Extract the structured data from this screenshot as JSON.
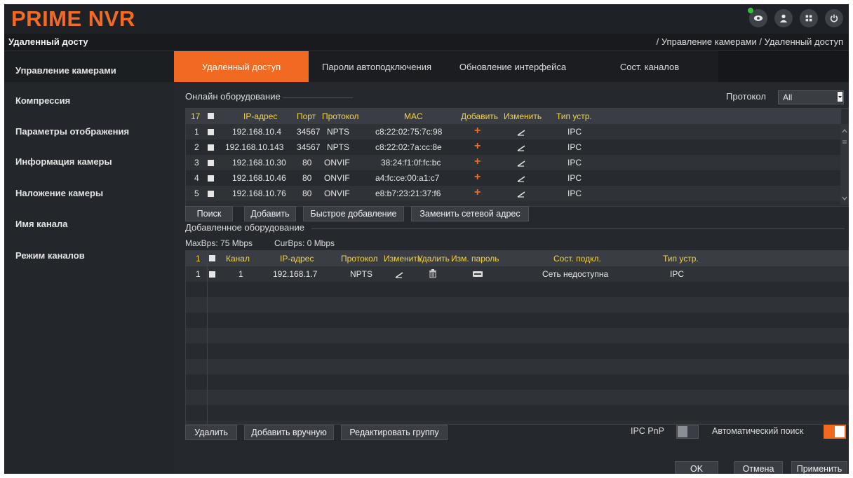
{
  "app": {
    "logo": "PRIME NVR",
    "page_title": "Удаленный досту",
    "breadcrumb": "/ Управление камерами / Удаленный доступ"
  },
  "sidebar": {
    "items": [
      {
        "label": "Управление камерами",
        "active": true
      },
      {
        "label": "Компрессия"
      },
      {
        "label": "Параметры отображения"
      },
      {
        "label": "Информация камеры"
      },
      {
        "label": "Наложение камеры"
      },
      {
        "label": "Имя канала"
      },
      {
        "label": "Режим каналов"
      }
    ]
  },
  "tabs": [
    {
      "label": "Удаленный доступ",
      "active": true
    },
    {
      "label": "Пароли автоподключения"
    },
    {
      "label": "Обновление интерфейса"
    },
    {
      "label": "Сост. каналов"
    }
  ],
  "online": {
    "section_title": "Онлайн оборудование",
    "protocol_label": "Протокол",
    "protocol_value": "All",
    "headers": {
      "count": "17",
      "ip": "IP-адрес",
      "port": "Порт",
      "protocol": "Протокол",
      "mac": "MAC",
      "add": "Добавить",
      "edit": "Изменить",
      "type": "Тип устр."
    },
    "rows": [
      {
        "num": "1",
        "ip": "192.168.10.4",
        "port": "34567",
        "protocol": "NPTS",
        "mac": "c8:22:02:75:7c:98",
        "type": "IPC"
      },
      {
        "num": "2",
        "ip": "192.168.10.143",
        "port": "34567",
        "protocol": "NPTS",
        "mac": "c8:22:02:7a:cc:8e",
        "type": "IPC"
      },
      {
        "num": "3",
        "ip": "192.168.10.30",
        "port": "80",
        "protocol": "ONVIF",
        "mac": "38:24:f1:0f:fc:bc",
        "type": "IPC"
      },
      {
        "num": "4",
        "ip": "192.168.10.46",
        "port": "80",
        "protocol": "ONVIF",
        "mac": "a4:fc:ce:00:a1:c7",
        "type": "IPC"
      },
      {
        "num": "5",
        "ip": "192.168.10.76",
        "port": "80",
        "protocol": "ONVIF",
        "mac": "e8:b7:23:21:37:f6",
        "type": "IPC"
      }
    ],
    "buttons": {
      "search": "Поиск",
      "add": "Добавить",
      "quick_add": "Быстрое добавление",
      "replace_ip": "Заменить сетевой адрес"
    }
  },
  "added": {
    "section_title": "Добавленное оборудование",
    "max_bps": "MaxBps: 75 Mbps",
    "cur_bps": "CurBps: 0 Mbps",
    "headers": {
      "count": "1",
      "channel": "Канал",
      "ip": "IP-адрес",
      "protocol": "Протокол",
      "edit": "Изменить",
      "delete": "Удалить",
      "password": "Изм. пароль",
      "status": "Сост. подкл.",
      "type": "Тип устр."
    },
    "rows": [
      {
        "num": "1",
        "channel": "1",
        "ip": "192.168.1.7",
        "protocol": "NPTS",
        "status": "Сеть недоступна",
        "type": "IPC"
      }
    ],
    "buttons": {
      "delete": "Удалить",
      "add_manual": "Добавить вручную",
      "edit_group": "Редактировать группу"
    },
    "ipc_pnp_label": "IPC PnP",
    "ipc_pnp_on": false,
    "auto_search_label": "Автоматический поиск",
    "auto_search_on": true
  },
  "footer": {
    "ok": "OK",
    "cancel": "Отмена",
    "apply": "Применить"
  },
  "colors": {
    "accent": "#f26a21",
    "header_text": "#f3d24a",
    "background": "#202327"
  }
}
